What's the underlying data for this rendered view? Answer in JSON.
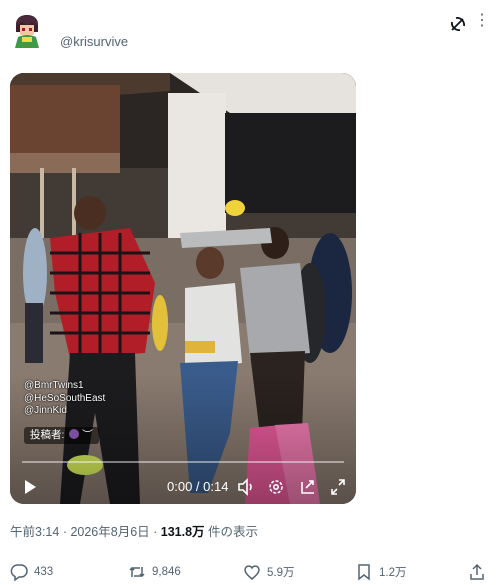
{
  "author": {
    "handle": "@krisurvive"
  },
  "video": {
    "watermark_lines": [
      "@BmrTwins1",
      "@HeSoSouthEast",
      "@JinnKid"
    ],
    "poster_label": "投稿者:",
    "poster_suffix": "︶",
    "time": "0:00 / 0:14",
    "progress": 0
  },
  "meta": {
    "time": "午前3:14",
    "sep1": " · ",
    "date": "2026年8月6日",
    "sep2": " · ",
    "views": "131.8万",
    "views_suffix": " 件の表示"
  },
  "actions": {
    "replies": "433",
    "reposts": "9,846",
    "likes": "5.9万",
    "bookmarks": "1.2万"
  },
  "icons": [
    "grok-icon",
    "more-icon",
    "play-icon",
    "volume-icon",
    "settings-icon",
    "pip-icon",
    "fullscreen-icon",
    "reply-icon",
    "repost-icon",
    "like-icon",
    "bookmark-icon",
    "share-icon"
  ],
  "colors": {
    "text_secondary": "#536471",
    "text_primary": "#0f1419"
  }
}
